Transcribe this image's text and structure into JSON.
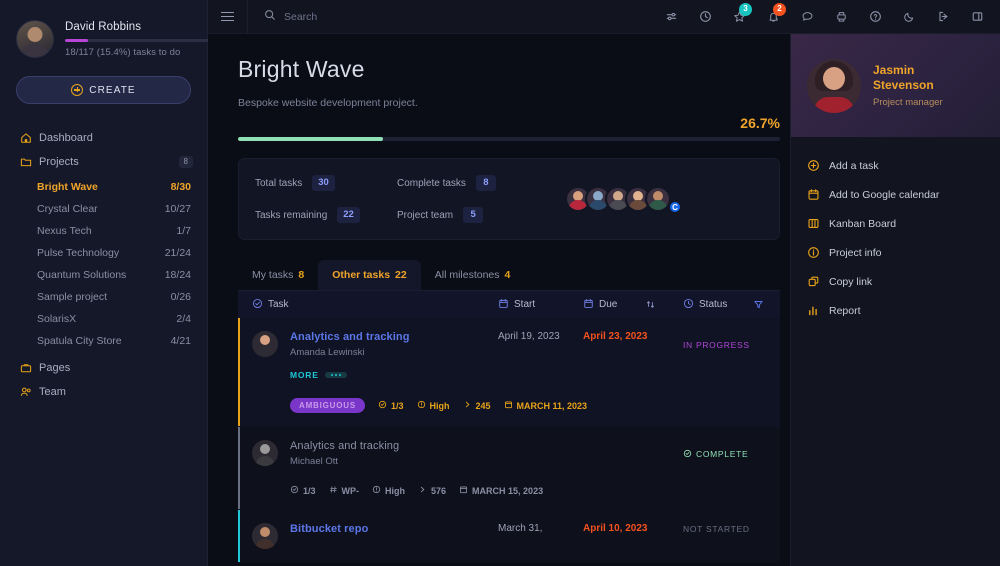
{
  "sidebar": {
    "user": {
      "name": "David Robbins",
      "progress_text": "18/117 (15.4%) tasks to do",
      "progress_pct": 15.4
    },
    "create_label": "CREATE",
    "nav": [
      {
        "label": "Dashboard",
        "icon": "home-icon",
        "count": ""
      },
      {
        "label": "Projects",
        "icon": "folder-icon",
        "count": "8"
      }
    ],
    "projects": [
      {
        "name": "Bright Wave",
        "count": "8/30",
        "active": true
      },
      {
        "name": "Crystal Clear",
        "count": "10/27",
        "active": false
      },
      {
        "name": "Nexus Tech",
        "count": "1/7",
        "active": false
      },
      {
        "name": "Pulse Technology",
        "count": "21/24",
        "active": false
      },
      {
        "name": "Quantum Solutions",
        "count": "18/24",
        "active": false
      },
      {
        "name": "Sample project",
        "count": "0/26",
        "active": false
      },
      {
        "name": "SolarisX",
        "count": "2/4",
        "active": false
      },
      {
        "name": "Spatula City Store",
        "count": "4/21",
        "active": false
      }
    ],
    "nav_bottom": [
      {
        "label": "Pages",
        "icon": "briefcase-icon"
      },
      {
        "label": "Team",
        "icon": "people-icon"
      }
    ]
  },
  "topbar": {
    "menu_icon": "hamburger-icon",
    "search_placeholder": "Search",
    "icons": [
      {
        "name": "sliders-icon",
        "badge": ""
      },
      {
        "name": "clock-icon",
        "badge": ""
      },
      {
        "name": "star-icon",
        "badge": "3",
        "badge_color": "teal"
      },
      {
        "name": "bell-icon",
        "badge": "2",
        "badge_color": "orange"
      },
      {
        "name": "chat-icon",
        "badge": ""
      },
      {
        "name": "print-icon",
        "badge": ""
      },
      {
        "name": "help-icon",
        "badge": ""
      },
      {
        "name": "moon-icon",
        "badge": ""
      },
      {
        "name": "logout-icon",
        "badge": ""
      },
      {
        "name": "panel-icon",
        "badge": ""
      }
    ]
  },
  "project": {
    "title": "Bright Wave",
    "description": "Bespoke website development project.",
    "percent_label": "26.7%",
    "percent_value": 26.7
  },
  "stats": [
    {
      "label": "Total tasks",
      "value": "30"
    },
    {
      "label": "Complete tasks",
      "value": "8"
    },
    {
      "label": "Tasks remaining",
      "value": "22"
    },
    {
      "label": "Project team",
      "value": "5"
    }
  ],
  "team_avatar_count": 5,
  "tabs": [
    {
      "label": "My tasks",
      "count": "8",
      "active": false
    },
    {
      "label": "Other tasks",
      "count": "22",
      "active": true
    },
    {
      "label": "All milestones",
      "count": "4",
      "active": false
    }
  ],
  "table": {
    "headers": {
      "task": "Task",
      "start": "Start",
      "due": "Due",
      "status": "Status",
      "task_icon": "check-circle-icon",
      "start_icon": "calendar-icon",
      "due_icon": "calendar-icon",
      "sort_icon": "sort-icon",
      "status_icon": "clock-icon",
      "filter_icon": "filter-icon"
    },
    "rows": [
      {
        "accent": "amber",
        "title": "Analytics and tracking",
        "assignee": "Amanda Lewinski",
        "start": "April 19, 2023",
        "due": "April 23, 2023",
        "status": "IN PROGRESS",
        "status_kind": "progress",
        "more_label": "MORE",
        "tag": "AMBIGUOUS",
        "meta": [
          {
            "icon": "check-circle-icon",
            "text": "1/3",
            "tone": "amber"
          },
          {
            "icon": "alert-icon",
            "text": "High",
            "tone": "amber"
          },
          {
            "icon": "chevron-icon",
            "text": "245",
            "tone": "amber"
          },
          {
            "icon": "calendar-icon",
            "text": "MARCH 11, 2023",
            "tone": "amber"
          }
        ]
      },
      {
        "accent": "gray",
        "title": "Analytics and tracking",
        "assignee": "Michael Ott",
        "start": "",
        "due": "",
        "status": "COMPLETE",
        "status_kind": "complete",
        "more_label": "",
        "tag": "",
        "meta": [
          {
            "icon": "check-circle-icon",
            "text": "1/3",
            "tone": "gray"
          },
          {
            "icon": "hash-icon",
            "text": "WP-",
            "tone": "gray"
          },
          {
            "icon": "alert-icon",
            "text": "High",
            "tone": "gray"
          },
          {
            "icon": "chevron-icon",
            "text": "576",
            "tone": "gray"
          },
          {
            "icon": "calendar-icon",
            "text": "MARCH 15, 2023",
            "tone": "gray"
          }
        ]
      },
      {
        "accent": "cyan",
        "title": "Bitbucket repo",
        "assignee": "",
        "start": "March 31,",
        "due": "April 10, 2023",
        "status": "NOT STARTED",
        "status_kind": "notstarted",
        "more_label": "",
        "tag": "",
        "meta": []
      }
    ]
  },
  "right_panel": {
    "person": {
      "name_line1": "Jasmin",
      "name_line2": "Stevenson",
      "role": "Project manager"
    },
    "menu": [
      {
        "label": "Add a task",
        "icon": "plus-circle-icon"
      },
      {
        "label": "Add to Google calendar",
        "icon": "calendar-icon"
      },
      {
        "label": "Kanban Board",
        "icon": "board-icon"
      },
      {
        "label": "Project info",
        "icon": "info-icon"
      },
      {
        "label": "Copy link",
        "icon": "copy-icon"
      },
      {
        "label": "Report",
        "icon": "chart-bar-icon"
      }
    ]
  },
  "colors": {
    "accent_amber": "#f0a42a",
    "accent_cyan": "#1ec8d8",
    "accent_green": "#8fe0b4",
    "accent_red": "#f4521f",
    "accent_purple": "#b145d8",
    "accent_blue": "#5b76e8"
  }
}
